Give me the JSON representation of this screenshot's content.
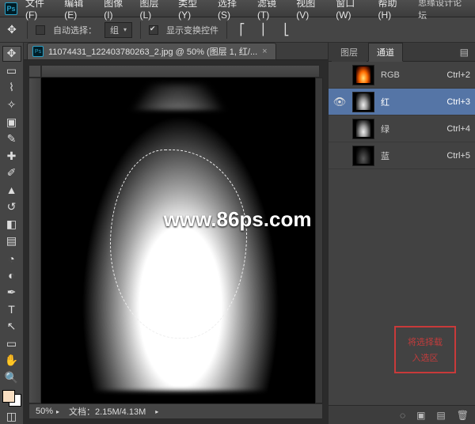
{
  "menubar": {
    "items": [
      "文件(F)",
      "编辑(E)",
      "图像(I)",
      "图层(L)",
      "类型(Y)",
      "选择(S)",
      "滤镜(T)",
      "视图(V)",
      "窗口(W)",
      "帮助(H)"
    ],
    "rightText": "思缘设计论坛"
  },
  "optionbar": {
    "autoSelectLabel": "自动选择：",
    "autoSelectValue": "组",
    "showTransformLabel": "显示变换控件"
  },
  "document": {
    "tabTitle": "11074431_122403780263_2.jpg @ 50% (图层 1, 红/...",
    "zoom": "50%",
    "docInfoLabel": "文档：",
    "docInfo": "2.15M/4.13M"
  },
  "panel": {
    "tabs": {
      "layers": "图层",
      "channels": "通道"
    },
    "channels": [
      {
        "name": "RGB",
        "shortcut": "Ctrl+2",
        "eye": false,
        "sel": false,
        "thumb": "fl"
      },
      {
        "name": "红",
        "shortcut": "Ctrl+3",
        "eye": true,
        "sel": true,
        "thumb": "gr"
      },
      {
        "name": "绿",
        "shortcut": "Ctrl+4",
        "eye": false,
        "sel": false,
        "thumb": "gr"
      },
      {
        "name": "蓝",
        "shortcut": "Ctrl+5",
        "eye": false,
        "sel": false,
        "thumb": "dk"
      }
    ],
    "redBox": {
      "line1": "将选择载",
      "line2": "入选区"
    }
  },
  "watermark": "www.86ps.com"
}
